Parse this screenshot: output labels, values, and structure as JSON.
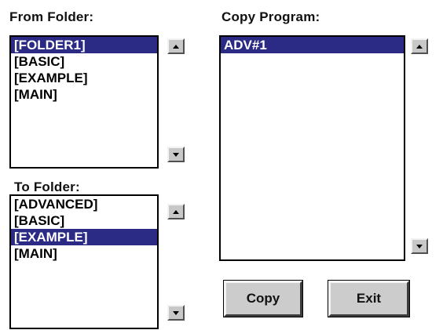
{
  "from_folder": {
    "label": "From Folder:",
    "items": [
      "[FOLDER1]",
      "[BASIC]",
      "[EXAMPLE]",
      "[MAIN]"
    ],
    "selected_index": 0
  },
  "to_folder": {
    "label": "To Folder:",
    "items": [
      "[ADVANCED]",
      "[BASIC]",
      "[EXAMPLE]",
      "[MAIN]"
    ],
    "selected_index": 2
  },
  "copy_program": {
    "label": "Copy Program:",
    "items": [
      "ADV#1"
    ],
    "selected_index": 0
  },
  "buttons": {
    "copy": "Copy",
    "exit": "Exit"
  },
  "colors": {
    "selection": "#2b2a84",
    "button_face": "#cccccc"
  }
}
